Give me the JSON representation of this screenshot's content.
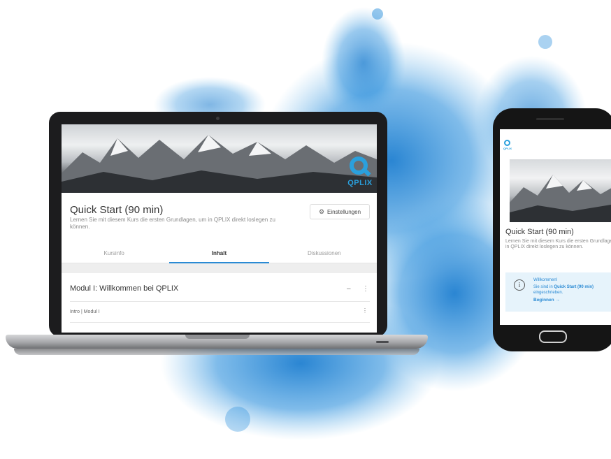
{
  "laptop": {
    "logo_text": "QPLIX",
    "course_title": "Quick Start (90 min)",
    "course_description": "Lernen Sie mit diesem Kurs die ersten Grundlagen, um in QPLIX direkt loslegen zu können.",
    "settings_label": "Einstellungen",
    "tabs": [
      {
        "label": "Kursinfo",
        "active": false
      },
      {
        "label": "Inhalt",
        "active": true
      },
      {
        "label": "Diskussionen",
        "active": false
      }
    ],
    "module": {
      "title": "Modul I: Willkommen bei QPLIX",
      "collapse_symbol": "–",
      "menu_symbol": "⋮",
      "lessons": [
        {
          "title": "Intro | Modul I",
          "menu_symbol": "⋮"
        }
      ]
    }
  },
  "phone": {
    "logo_text": "QPLIX",
    "course_title": "Quick Start (90 min)",
    "course_description": "Lernen Sie mit diesem Kurs die ersten Grundlagen, um in QPLIX direkt loslegen zu können.",
    "info_icon": "i",
    "welcome_title": "Willkommen!",
    "enrolled_prefix": "Sie sind in",
    "enrolled_course": "Quick Start (90 min)",
    "enrolled_suffix": "eingeschrieben.",
    "begin_label": "Beginnen →"
  },
  "colors": {
    "accent": "#2a8ad4",
    "brand": "#2aa0dd",
    "splash": "#1f7fd0"
  }
}
